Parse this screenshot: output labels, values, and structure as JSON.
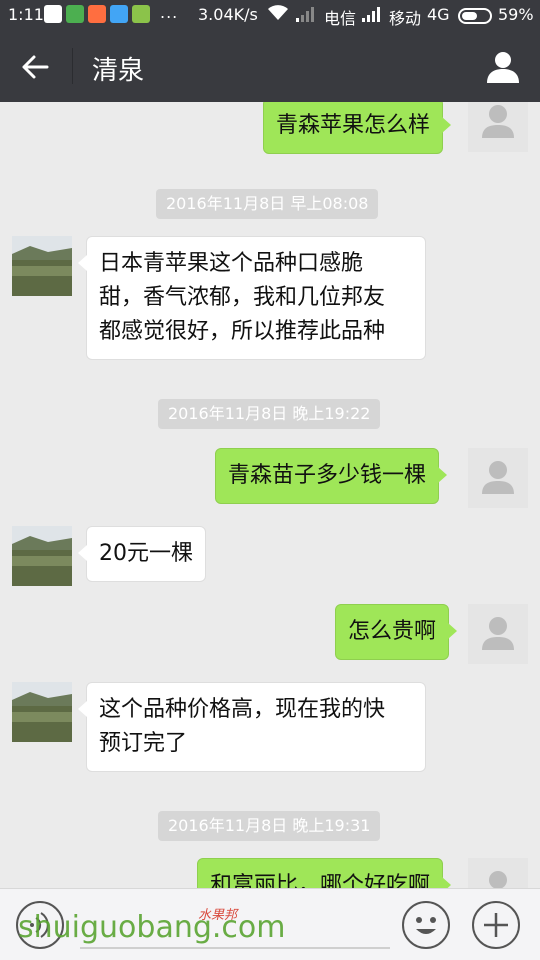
{
  "statusbar": {
    "time": "1:11",
    "dots": "...",
    "speed": "3.04K/s",
    "carrier1": "电信",
    "carrier2": "移动",
    "network": "4G",
    "battery": "59%",
    "battery_level": 0.59
  },
  "header": {
    "title": "清泉",
    "back_icon": "arrow-left-icon",
    "profile_icon": "person-icon"
  },
  "messages": [
    {
      "side": "me",
      "text": "青森苹果怎么样"
    },
    {
      "timestamp": "2016年11月8日 早上08:08"
    },
    {
      "side": "other",
      "text": "日本青苹果这个品种口感脆\n甜，香气浓郁，我和几位邦友\n都感觉很好，所以推荐此品种"
    },
    {
      "timestamp": "2016年11月8日 晚上19:22"
    },
    {
      "side": "me",
      "text": "青森苗子多少钱一棵"
    },
    {
      "side": "other",
      "text": "20元一棵"
    },
    {
      "side": "me",
      "text": "怎么贵啊"
    },
    {
      "side": "other",
      "text": "这个品种价格高，现在我的快\n预订完了"
    },
    {
      "timestamp": "2016年11月8日 晚上19:31"
    },
    {
      "side": "me",
      "text": "和富丽比，哪个好吃啊"
    }
  ],
  "inputbar": {
    "voice_icon": "voice-icon",
    "emoji_icon": "emoji-icon",
    "plus_icon": "plus-icon"
  },
  "watermark": {
    "text": "shuiguobang.com",
    "cn": "水果邦"
  },
  "colors": {
    "header": "#393a3f",
    "my_bubble": "#9fe658",
    "background": "#ebebeb"
  }
}
